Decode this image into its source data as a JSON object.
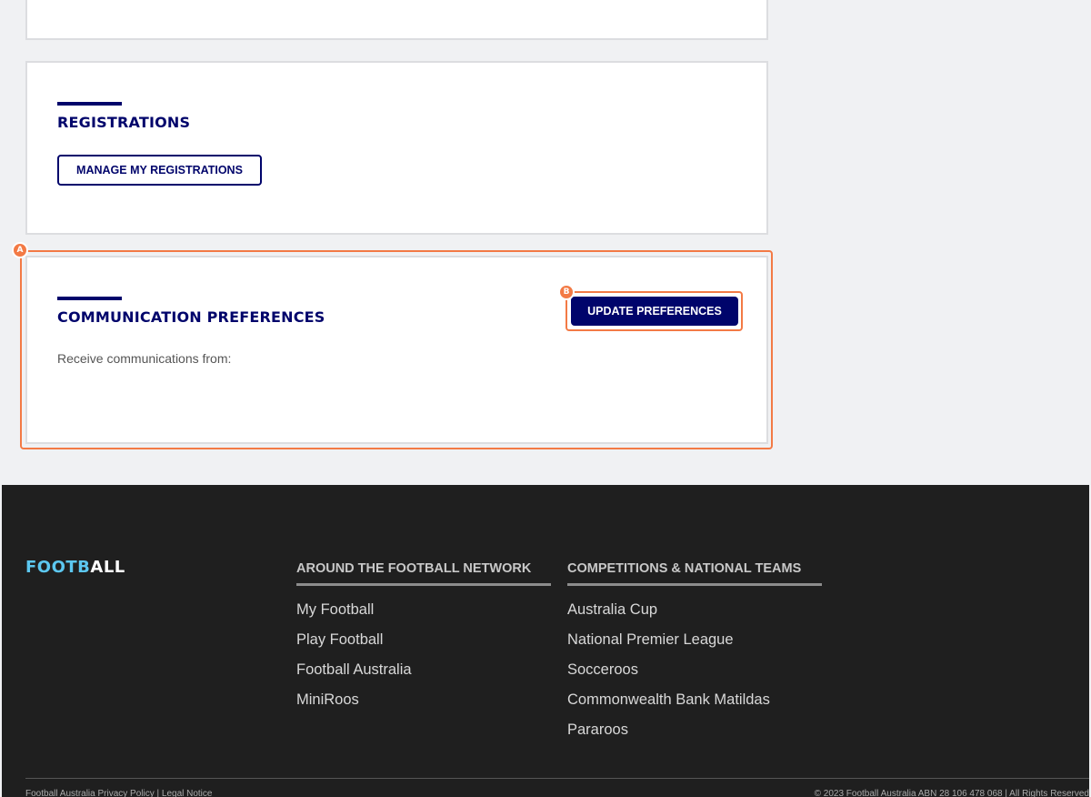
{
  "registrations": {
    "title": "REGISTRATIONS",
    "button_label": "MANAGE MY REGISTRATIONS"
  },
  "communication": {
    "title": "COMMUNICATION PREFERENCES",
    "button_label": "UPDATE PREFERENCES",
    "receive_text": "Receive communications from:"
  },
  "annotations": {
    "a": "A",
    "b": "B"
  },
  "footer": {
    "logo_part1": "FOOTB",
    "logo_part2": "ALL",
    "column1": {
      "heading": "AROUND THE FOOTBALL NETWORK",
      "links": [
        "My Football",
        "Play Football",
        "Football Australia",
        "MiniRoos"
      ]
    },
    "column2": {
      "heading": "COMPETITIONS & NATIONAL TEAMS",
      "links": [
        "Australia Cup",
        "National Premier League",
        "Socceroos",
        "Commonwealth Bank Matildas",
        "Pararoos"
      ]
    },
    "bottom_left": "Football Australia Privacy Policy | Legal Notice",
    "bottom_right": "© 2023 Football Australia ABN 28 106 478 068 | All Rights Reserved"
  },
  "colors": {
    "brand_navy": "#00046b",
    "annotation_orange": "#f37a45",
    "logo_blue": "#5cc7f0",
    "footer_bg": "#1f1f1f"
  }
}
